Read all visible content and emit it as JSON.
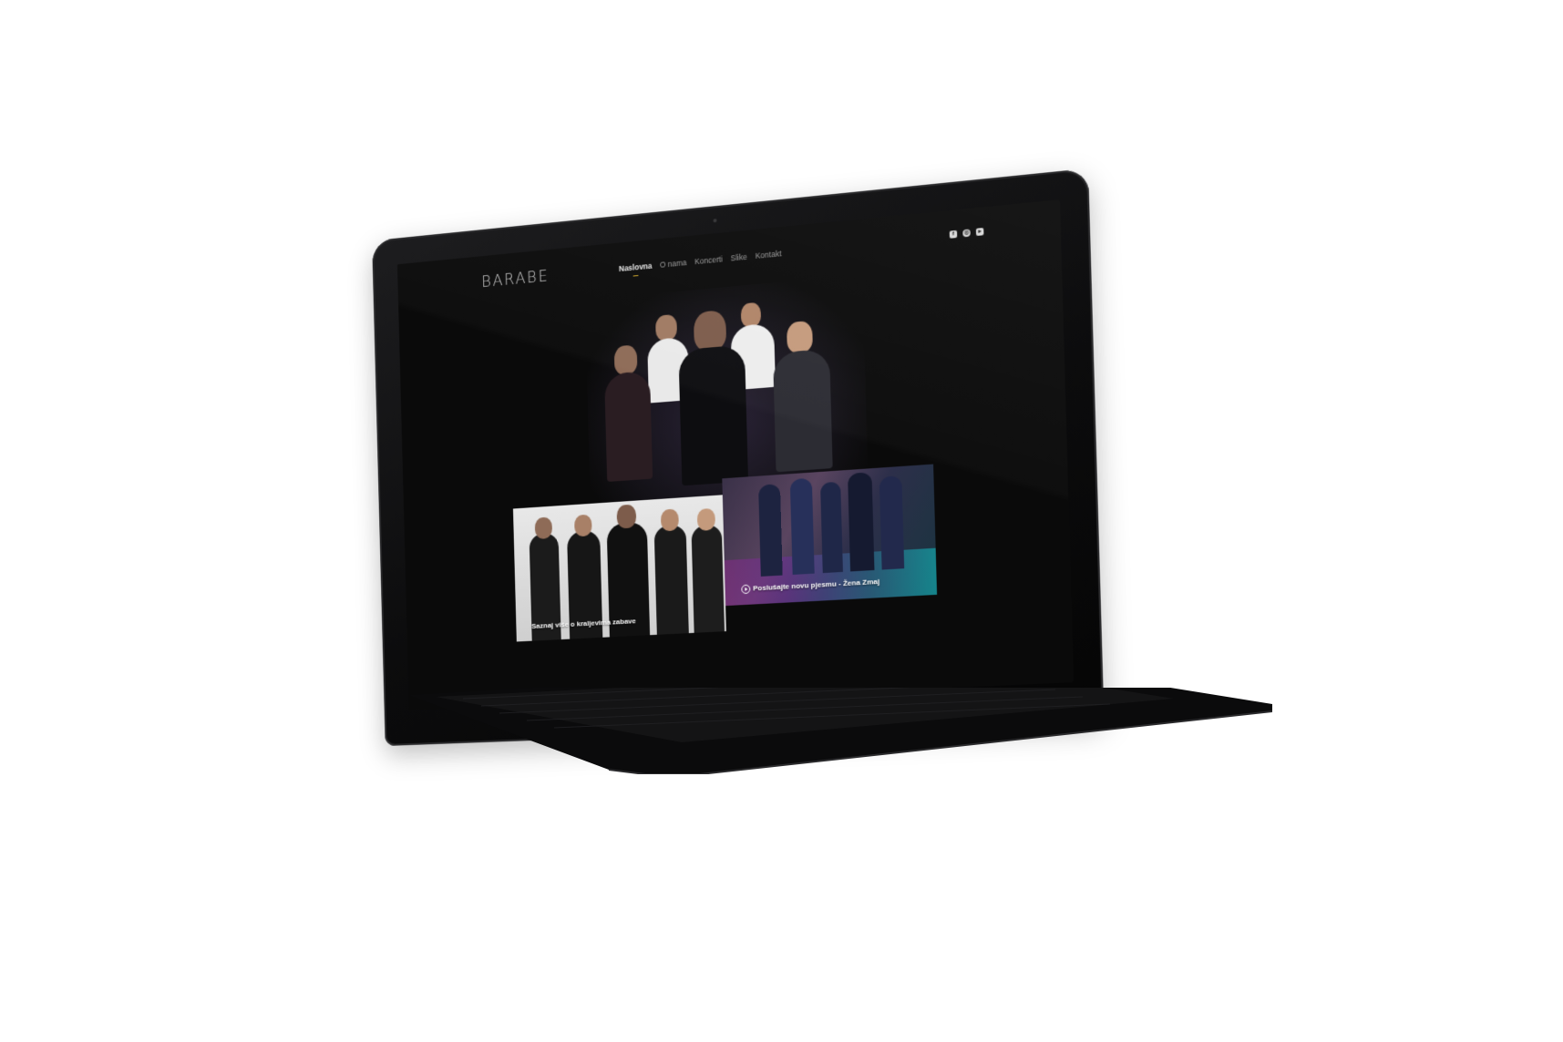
{
  "site": {
    "logo": "BARABE",
    "nav": [
      {
        "label": "Naslovna",
        "active": true
      },
      {
        "label": "O nama",
        "active": false
      },
      {
        "label": "Koncerti",
        "active": false
      },
      {
        "label": "Slike",
        "active": false
      },
      {
        "label": "Kontakt",
        "active": false
      }
    ],
    "social_icons": [
      "facebook-icon",
      "instagram-icon",
      "youtube-icon"
    ]
  },
  "cards": {
    "left_caption": "Saznaj više o kraljevima zabave",
    "right_caption_prefix": "Poslušajte novu pjesmu - ",
    "right_caption_song": "Žena Zmaj"
  },
  "colors": {
    "accent": "#c9a227",
    "screen_bg": "#0a0a0a",
    "laptop_body": "#0c0c0d"
  }
}
